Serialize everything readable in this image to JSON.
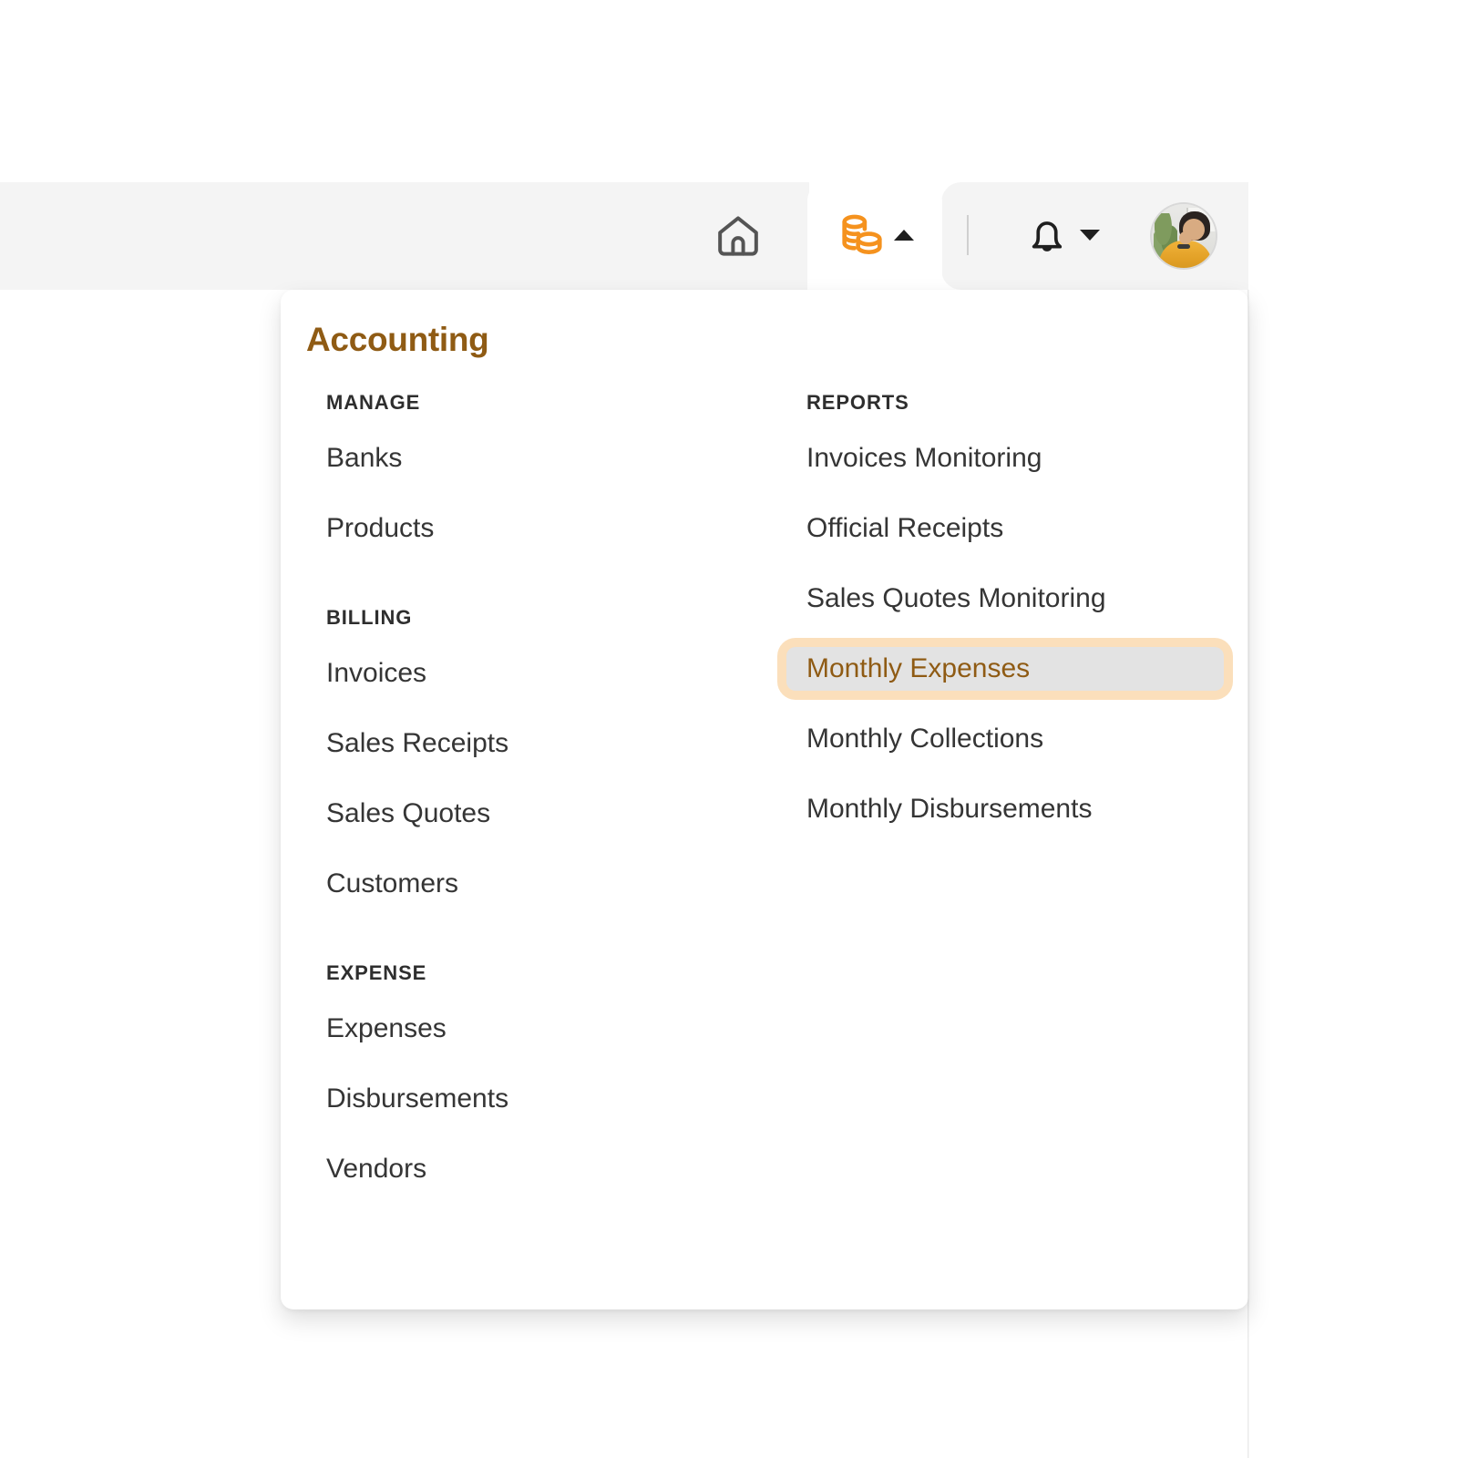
{
  "theme": {
    "brand_orange": "#f5921e",
    "brand_brown": "#8f5b14",
    "highlight_bg": "#e3e3e3",
    "highlight_ring": "#fbdfbb",
    "topbar_bg": "#f4f4f4",
    "text": "#353535"
  },
  "topbar": {
    "home_label": "Home",
    "accounting_label": "Accounting",
    "notifications_label": "Notifications",
    "account_label": "Account",
    "icons": {
      "home": "home-icon",
      "coins": "coins-icon",
      "caret_up": "caret-up-icon",
      "bell": "bell-icon",
      "caret_down": "caret-down-icon",
      "avatar": "avatar"
    }
  },
  "menu": {
    "title": "Accounting",
    "left_column": [
      {
        "heading": "MANAGE",
        "items": [
          {
            "label": "Banks",
            "selected": false
          },
          {
            "label": "Products",
            "selected": false
          }
        ]
      },
      {
        "heading": "BILLING",
        "items": [
          {
            "label": "Invoices",
            "selected": false
          },
          {
            "label": "Sales Receipts",
            "selected": false
          },
          {
            "label": "Sales Quotes",
            "selected": false
          },
          {
            "label": "Customers",
            "selected": false
          }
        ]
      },
      {
        "heading": "EXPENSE",
        "items": [
          {
            "label": "Expenses",
            "selected": false
          },
          {
            "label": "Disbursements",
            "selected": false
          },
          {
            "label": "Vendors",
            "selected": false
          }
        ]
      }
    ],
    "right_column": [
      {
        "heading": "REPORTS",
        "items": [
          {
            "label": "Invoices Monitoring",
            "selected": false
          },
          {
            "label": "Official Receipts",
            "selected": false
          },
          {
            "label": "Sales Quotes Monitoring",
            "selected": false
          },
          {
            "label": "Monthly Expenses",
            "selected": true
          },
          {
            "label": "Monthly Collections",
            "selected": false
          },
          {
            "label": "Monthly Disbursements",
            "selected": false
          }
        ]
      }
    ]
  }
}
